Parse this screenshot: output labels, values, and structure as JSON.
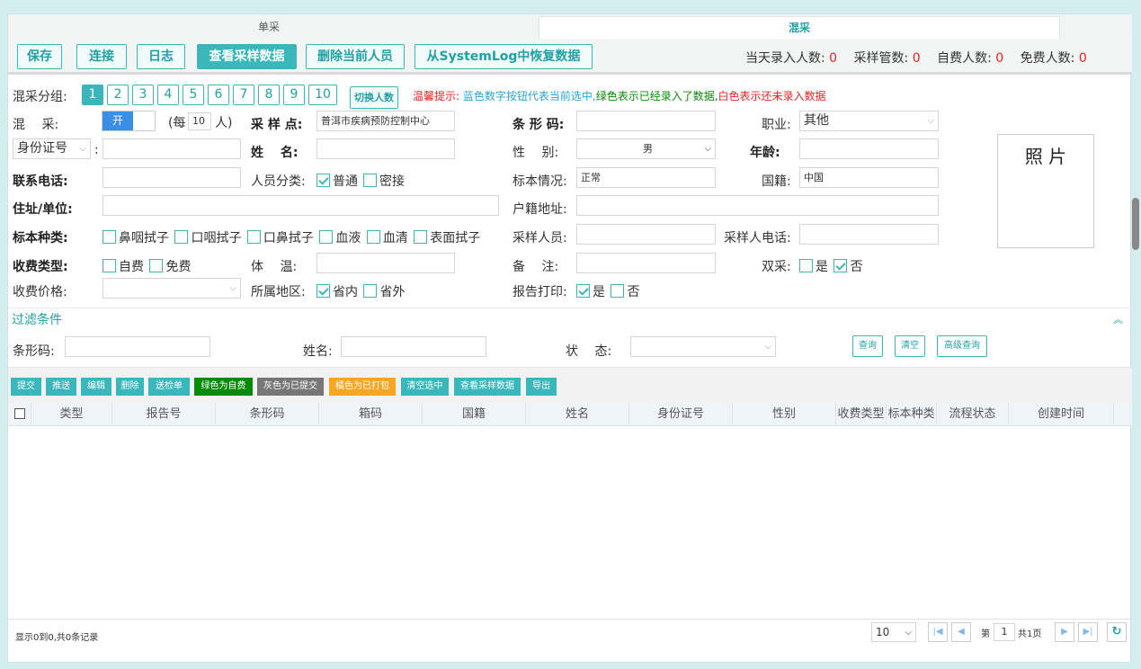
{
  "tabs": {
    "single": "单采",
    "mixed": "混采"
  },
  "toolbar": {
    "save": "保存",
    "connect": "连接",
    "log": "日志",
    "view_sample": "查看采样数据",
    "delete_person": "删除当前人员",
    "restore": "从SystemLog中恢复数据"
  },
  "stats": {
    "today_label": "当天录入人数:",
    "today_value": "0",
    "tubes_label": "采样管数:",
    "tubes_value": "0",
    "self_pay_label": "自费人数:",
    "self_pay_value": "0",
    "free_label": "免费人数:",
    "free_value": "0"
  },
  "group": {
    "label": "混采分组:",
    "buttons": [
      "1",
      "2",
      "3",
      "4",
      "5",
      "6",
      "7",
      "8",
      "9",
      "10"
    ],
    "selected": "1",
    "switch_label": "切换人数",
    "hint_prefix": "温馨提示:",
    "hint_blue": "蓝色数字按钮代表当前选中,",
    "hint_green": "绿色表示已经录入了数据,",
    "hint_red": "白色表示还未录入数据"
  },
  "form": {
    "mix_label": "混　 采:",
    "mix_toggle": "开",
    "per_label_left": "(每",
    "per_value": "10",
    "per_label_right": "人)",
    "site_label": "采 样 点:",
    "site_value": "普洱市疾病预防控制中心",
    "barcode_label": "条 形 码:",
    "barcode_value": "",
    "job_label": "职业:",
    "job_value": "其他",
    "idtype_value": "身份证号",
    "id_colon": ":",
    "id_value": "",
    "name_label": "姓　 名:",
    "name_value": "",
    "gender_label": "性　 别:",
    "gender_value": "男",
    "age_label": "年龄:",
    "age_value": "",
    "phone_label": "联系电话:",
    "phone_value": "",
    "category_label": "人员分类:",
    "category_normal": "普通",
    "category_contact": "密接",
    "specimen_status_label": "标本情况:",
    "specimen_status_value": "正常",
    "nation_label": "国籍:",
    "nation_value": "中国",
    "address_label": "住址/单位:",
    "address_value": "",
    "household_label": "户籍地址:",
    "household_value": "",
    "specimen_type_label": "标本种类:",
    "specimen_types": [
      "鼻咽拭子",
      "口咽拭子",
      "口鼻拭子",
      "血液",
      "血清",
      "表面拭子"
    ],
    "collector_label": "采样人员:",
    "collector_value": "",
    "collector_phone_label": "采样人电话:",
    "collector_phone_value": "",
    "fee_type_label": "收费类型:",
    "fee_self": "自费",
    "fee_free": "免费",
    "temp_label": "体　 温:",
    "temp_value": "",
    "remark_label": "备　 注:",
    "remark_value": "",
    "double_label": "双采:",
    "double_yes": "是",
    "double_no": "否",
    "price_label": "收费价格:",
    "price_value": "",
    "region_label": "所属地区:",
    "region_in": "省内",
    "region_out": "省外",
    "print_label": "报告打印:",
    "print_yes": "是",
    "print_no": "否",
    "photo_label": "照 片"
  },
  "filter": {
    "title": "过滤条件",
    "barcode_label": "条形码:",
    "barcode_value": "",
    "name_label": "姓名:",
    "name_value": "",
    "status_label": "状　 态:",
    "status_value": "",
    "query": "查询",
    "clear": "清空",
    "advanced": "高级查询"
  },
  "actions": {
    "submit": "提交",
    "push": "推送",
    "edit": "编辑",
    "delete": "删除",
    "send": "送检单",
    "green_self": "绿色为自费",
    "gray_submitted": "灰色为已提交",
    "orange_packed": "橘色为已打包",
    "clear_selected": "清空选中",
    "view_sample": "查看采样数据",
    "export": "导出"
  },
  "table": {
    "columns": [
      "类型",
      "报告号",
      "条形码",
      "箱码",
      "国籍",
      "姓名",
      "身份证号",
      "性别",
      "收费类型",
      "标本种类",
      "流程状态",
      "创建时间"
    ],
    "rows": []
  },
  "footer": {
    "summary": "显示0到0,共0条记录",
    "page_size": "10",
    "page_prefix": "第",
    "page_value": "1",
    "page_total": "共1页"
  },
  "colors": {
    "accent": "#3ab7ba",
    "green": "#0a8a0a",
    "gray": "#777777",
    "orange": "#f5a623",
    "red": "#e22222"
  }
}
